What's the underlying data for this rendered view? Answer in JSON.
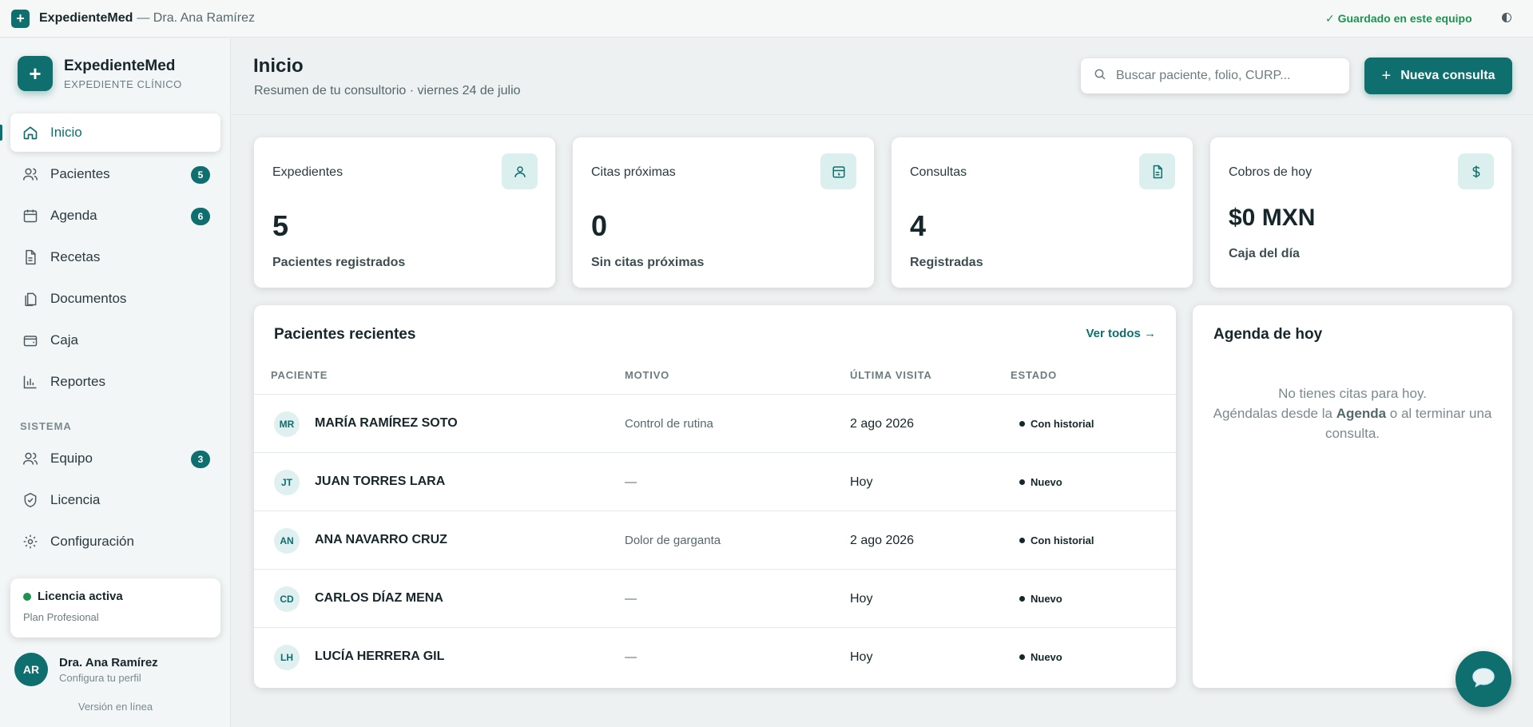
{
  "topbar": {
    "app_name": "ExpedienteMed",
    "subtitle": "— Dra. Ana Ramírez",
    "saved_status": "✓ Guardado en este equipo",
    "contrast_icon": "contrast-icon"
  },
  "brand": {
    "name": "ExpedienteMed",
    "subtitle": "EXPEDIENTE CLÍNICO"
  },
  "nav": {
    "items": [
      {
        "label": "Inicio",
        "icon": "home-icon",
        "active": true
      },
      {
        "label": "Pacientes",
        "icon": "users-icon",
        "badge": "5"
      },
      {
        "label": "Agenda",
        "icon": "calendar-icon",
        "badge": "6"
      },
      {
        "label": "Recetas",
        "icon": "file-icon"
      },
      {
        "label": "Documentos",
        "icon": "documents-icon"
      },
      {
        "label": "Caja",
        "icon": "wallet-icon"
      },
      {
        "label": "Reportes",
        "icon": "bar-chart-icon"
      }
    ],
    "section_label": "SISTEMA",
    "system_items": [
      {
        "label": "Equipo",
        "icon": "team-icon",
        "badge": "3"
      },
      {
        "label": "Licencia",
        "icon": "shield-check-icon"
      },
      {
        "label": "Configuración",
        "icon": "gear-icon"
      }
    ]
  },
  "license": {
    "title": "Licencia activa",
    "plan": "Plan Profesional",
    "status_color": "#1f9150"
  },
  "user": {
    "initials": "AR",
    "name": "Dra. Ana Ramírez",
    "subtitle": "Configura tu perfil"
  },
  "version": "Versión en línea",
  "header": {
    "title": "Inicio",
    "subtitle": "Resumen de tu consultorio · viernes 24 de julio",
    "search_placeholder": "Buscar paciente, folio, CURP...",
    "new_button": "Nueva consulta"
  },
  "stats": [
    {
      "label": "Expedientes",
      "value": "5",
      "caption": "Pacientes registrados",
      "icon": "user-icon"
    },
    {
      "label": "Citas próximas",
      "value": "0",
      "caption": "Sin citas próximas",
      "icon": "calendar-icon"
    },
    {
      "label": "Consultas",
      "value": "4",
      "caption": "Registradas",
      "icon": "document-icon"
    },
    {
      "label": "Cobros de hoy",
      "value": "$0 MXN",
      "caption": "Caja del día",
      "icon": "dollar-icon"
    }
  ],
  "recent": {
    "title": "Pacientes recientes",
    "see_all": "Ver todos →",
    "columns": [
      "PACIENTE",
      "MOTIVO",
      "ÚLTIMA VISITA",
      "ESTADO"
    ],
    "rows": [
      {
        "initials": "MR",
        "name": "MARÍA RAMÍREZ SOTO",
        "reason": "Control de rutina",
        "last_visit": "2 ago 2026",
        "status": "Con historial"
      },
      {
        "initials": "JT",
        "name": "JUAN TORRES LARA",
        "reason": "—",
        "last_visit": "Hoy",
        "status": "Nuevo"
      },
      {
        "initials": "AN",
        "name": "ANA NAVARRO CRUZ",
        "reason": "Dolor de garganta",
        "last_visit": "2 ago 2026",
        "status": "Con historial"
      },
      {
        "initials": "CD",
        "name": "CARLOS DÍAZ MENA",
        "reason": "—",
        "last_visit": "Hoy",
        "status": "Nuevo"
      },
      {
        "initials": "LH",
        "name": "LUCÍA HERRERA GIL",
        "reason": "—",
        "last_visit": "Hoy",
        "status": "Nuevo"
      }
    ]
  },
  "agenda": {
    "title": "Agenda de hoy",
    "empty_line1": "No tienes citas para hoy.",
    "empty_pre": "Agéndalas desde la",
    "empty_link": "Agenda",
    "empty_post": "o al terminar una consulta."
  },
  "colors": {
    "accent": "#0f6e6e",
    "success": "#1f9150",
    "background": "#eef1f1"
  }
}
